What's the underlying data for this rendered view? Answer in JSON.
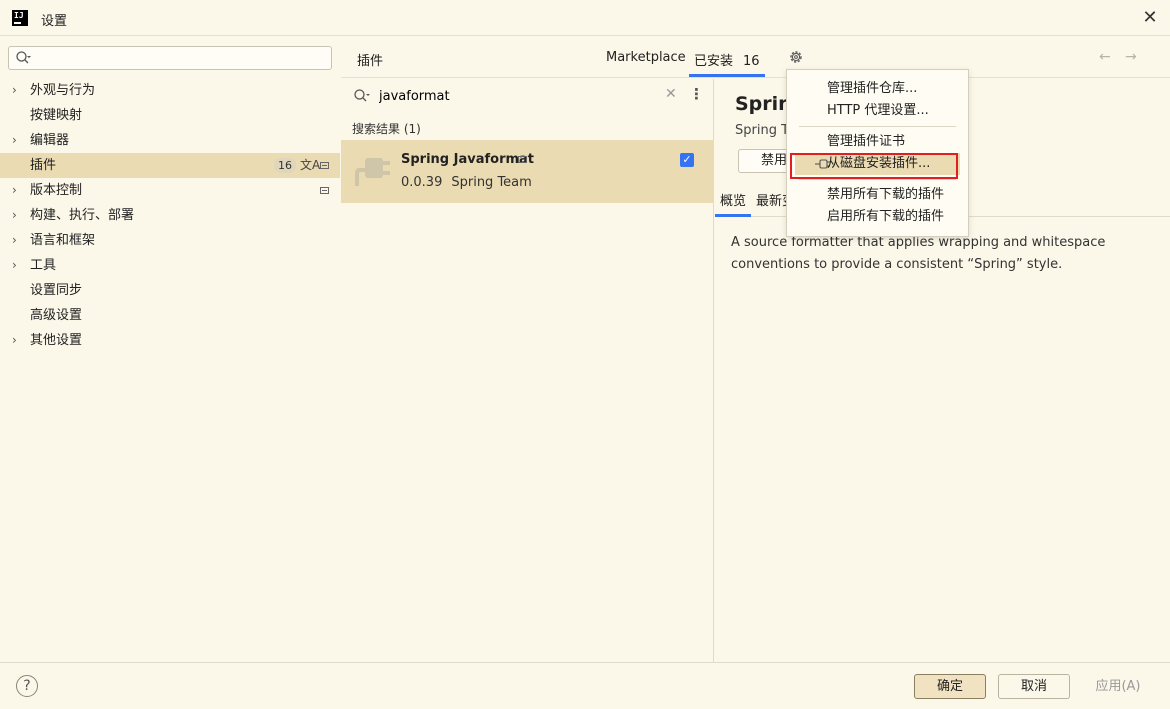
{
  "window": {
    "title": "设置",
    "logo_text": "IJ"
  },
  "sidebar": {
    "search_placeholder": "",
    "items": [
      {
        "label": "外观与行为",
        "expandable": true
      },
      {
        "label": "按键映射",
        "expandable": false
      },
      {
        "label": "编辑器",
        "expandable": true
      },
      {
        "label": "插件",
        "expandable": false,
        "selected": true,
        "badge": "16"
      },
      {
        "label": "版本控制",
        "expandable": true
      },
      {
        "label": "构建、执行、部署",
        "expandable": true
      },
      {
        "label": "语言和框架",
        "expandable": true
      },
      {
        "label": "工具",
        "expandable": true
      },
      {
        "label": "设置同步",
        "expandable": false
      },
      {
        "label": "高级设置",
        "expandable": false
      },
      {
        "label": "其他设置",
        "expandable": true
      }
    ],
    "translate_icon": "translate-icon"
  },
  "plugins": {
    "title": "插件",
    "tabs": {
      "marketplace": "Marketplace",
      "installed": "已安装",
      "installed_count": "16"
    },
    "search_value": "javaformat",
    "results_label": "搜索结果 (1)",
    "result": {
      "name": "Spring Javaformat",
      "version": "0.0.39",
      "vendor": "Spring Team",
      "enabled": true
    }
  },
  "detail": {
    "title": "Spring Javaformat",
    "vendor": "Spring Team",
    "disable_label": "禁用",
    "tab_overview": "概览",
    "tab_whatsnew": "最新变化",
    "description": "A source formatter that applies wrapping and whitespace conventions to provide a consistent “Spring” style."
  },
  "popup": {
    "items": [
      "管理插件仓库...",
      "HTTP 代理设置...",
      "管理插件证书",
      "从磁盘安装插件...",
      "禁用所有下载的插件",
      "启用所有下载的插件"
    ]
  },
  "footer": {
    "help": "?",
    "ok": "确定",
    "cancel": "取消",
    "apply": "应用(A)"
  },
  "colors": {
    "accent": "#3574f0",
    "selection": "#ebdbb2",
    "background": "#fbf7e9",
    "highlight": "#e02020"
  }
}
